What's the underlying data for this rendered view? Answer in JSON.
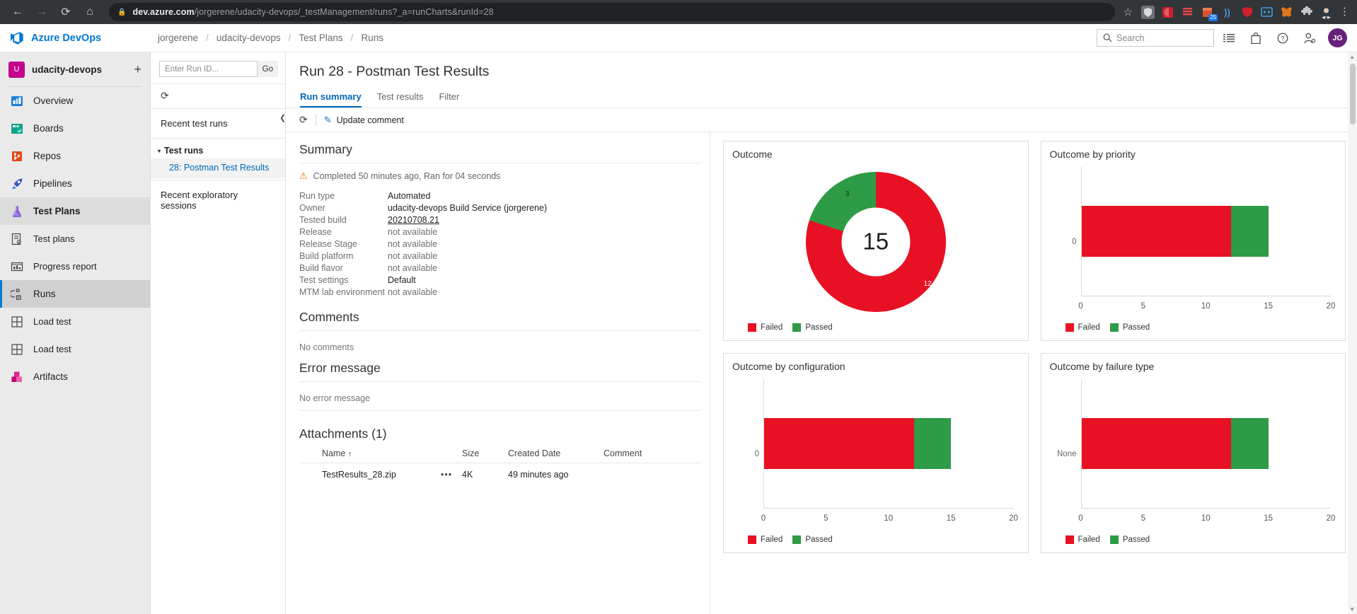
{
  "browser": {
    "back_icon": "back-arrow",
    "forward_icon": "forward-arrow",
    "reload_icon": "reload",
    "home_icon": "home",
    "lock_icon": "lock",
    "url_domain": "dev.azure.com",
    "url_path": "/jorgerene/udacity-devops/_testManagement/runs?_a=runCharts&runId=28",
    "star_icon": "bookmark-star",
    "menu_icon": "kebab-menu",
    "extensions": [
      {
        "name": "bitwarden-extension",
        "color": "#5a5f63",
        "glyph": "⛉"
      },
      {
        "name": "adobe-extension",
        "color": "#c8202f",
        "glyph": ""
      },
      {
        "name": "grammarly-extension",
        "color": "#e33d3d",
        "glyph": ""
      },
      {
        "name": "pocket-extension",
        "color": "#d9542b",
        "glyph": "",
        "badge": "25"
      },
      {
        "name": "wifi-extension",
        "color": "#1f6fd0",
        "glyph": "))"
      },
      {
        "name": "ublock-extension",
        "color": "#c8202f",
        "glyph": ""
      },
      {
        "name": "lastpass-extension",
        "color": "#0b82c9",
        "glyph": ""
      },
      {
        "name": "metamask-extension",
        "color": "#e2761b",
        "glyph": ""
      },
      {
        "name": "puzzle-extension",
        "color": "#b9bcbe",
        "glyph": ""
      },
      {
        "name": "profile-avatar",
        "color": "#8e7b6b",
        "glyph": ""
      }
    ]
  },
  "header": {
    "logo_icon": "azure-devops-logo",
    "logo_text": "Azure DevOps",
    "breadcrumb": [
      "jorgerene",
      "udacity-devops",
      "Test Plans",
      "Runs"
    ],
    "breadcrumb_separator": "/",
    "search_placeholder": "Search",
    "search_icon": "search-icon",
    "icons": [
      {
        "name": "backlog-icon",
        "glyph": "≣"
      },
      {
        "name": "marketplace-bag-icon",
        "glyph": "▭"
      },
      {
        "name": "help-icon",
        "glyph": "?"
      },
      {
        "name": "user-settings-icon",
        "glyph": "☺"
      }
    ],
    "avatar_initials": "JG"
  },
  "sidebar": {
    "project_initial": "U",
    "project_name": "udacity-devops",
    "add_icon": "plus-icon",
    "items": [
      {
        "label": "Overview",
        "icon": "overview-icon",
        "state": "normal"
      },
      {
        "label": "Boards",
        "icon": "boards-icon",
        "state": "normal"
      },
      {
        "label": "Repos",
        "icon": "repos-icon",
        "state": "normal"
      },
      {
        "label": "Pipelines",
        "icon": "pipelines-icon",
        "state": "normal"
      },
      {
        "label": "Test Plans",
        "icon": "test-plans-icon",
        "state": "group-active"
      },
      {
        "label": "Test plans",
        "icon": "test-plan-doc-icon",
        "state": "sub"
      },
      {
        "label": "Progress report",
        "icon": "progress-report-icon",
        "state": "sub"
      },
      {
        "label": "Runs",
        "icon": "runs-icon",
        "state": "active"
      },
      {
        "label": "Load test",
        "icon": "grid-icon",
        "state": "sub"
      },
      {
        "label": "Load test",
        "icon": "grid-icon",
        "state": "sub"
      },
      {
        "label": "Artifacts",
        "icon": "artifacts-icon",
        "state": "normal"
      }
    ]
  },
  "runs_pane": {
    "run_id_placeholder": "Enter Run ID...",
    "go_label": "Go",
    "refresh_icon": "refresh-icon",
    "recent_test_runs": "Recent test runs",
    "group_label": "Test runs",
    "collapse_caret": "▼",
    "selected_run": "28: Postman Test Results",
    "recent_exploratory": "Recent exploratory sessions",
    "collapse_panel_icon": "chevron-left-icon"
  },
  "main": {
    "title": "Run 28 - Postman Test Results",
    "tabs": [
      {
        "label": "Run summary",
        "active": true
      },
      {
        "label": "Test results",
        "active": false
      },
      {
        "label": "Filter",
        "active": false
      }
    ],
    "toolbar": {
      "refresh_icon": "refresh-icon",
      "update_comment_icon": "pencil-icon",
      "update_comment_label": "Update comment"
    },
    "summary": {
      "heading": "Summary",
      "warning_icon": "warning-triangle-icon",
      "status_text": "Completed 50 minutes ago, Ran for 04 seconds",
      "fields": [
        {
          "key": "Run type",
          "value": "Automated",
          "style": "normal"
        },
        {
          "key": "Owner",
          "value": "udacity-devops Build Service (jorgerene)",
          "style": "normal"
        },
        {
          "key": "Tested build",
          "value": "20210708.21",
          "style": "link"
        },
        {
          "key": "Release",
          "value": "not available",
          "style": "muted"
        },
        {
          "key": "Release Stage",
          "value": "not available",
          "style": "muted"
        },
        {
          "key": "Build platform",
          "value": "not available",
          "style": "muted"
        },
        {
          "key": "Build flavor",
          "value": "not available",
          "style": "muted"
        },
        {
          "key": "Test settings",
          "value": "Default",
          "style": "normal"
        },
        {
          "key": "MTM lab environment",
          "value": "not available",
          "style": "muted"
        }
      ]
    },
    "comments": {
      "heading": "Comments",
      "body": "No comments"
    },
    "error_message": {
      "heading": "Error message",
      "body": "No error message"
    },
    "attachments": {
      "heading": "Attachments (1)",
      "sort_indicator": "↑",
      "columns": [
        "Name",
        "Size",
        "Created Date",
        "Comment"
      ],
      "rows": [
        {
          "name": "TestResults_28.zip",
          "overflow": "•••",
          "size": "4K",
          "created": "49 minutes ago",
          "comment": ""
        }
      ]
    }
  },
  "colors": {
    "failed": "#e81123",
    "passed": "#2e9b46",
    "accent": "#0078d4",
    "link": "#0067b8"
  },
  "chart_data": [
    {
      "type": "pie",
      "title": "Outcome",
      "center_label": "15",
      "total": 15,
      "categories": [
        "Failed",
        "Passed"
      ],
      "values": [
        12,
        3
      ],
      "colors": [
        "#e81123",
        "#2e9b46"
      ],
      "slice_labels": [
        "12",
        "3"
      ],
      "legend": [
        "Failed",
        "Passed"
      ],
      "legend_position": "bottom"
    },
    {
      "type": "bar",
      "title": "Outcome by priority",
      "orientation": "horizontal",
      "stacked": true,
      "categories": [
        "0"
      ],
      "ylabel": "",
      "xlabel": "",
      "xlim": [
        0,
        20
      ],
      "xticks": [
        0,
        5,
        10,
        15,
        20
      ],
      "grid": false,
      "series": [
        {
          "name": "Failed",
          "values": [
            12
          ],
          "color": "#e81123"
        },
        {
          "name": "Passed",
          "values": [
            3
          ],
          "color": "#2e9b46"
        }
      ],
      "legend": [
        "Failed",
        "Passed"
      ],
      "legend_position": "bottom"
    },
    {
      "type": "bar",
      "title": "Outcome by configuration",
      "orientation": "horizontal",
      "stacked": true,
      "categories": [
        "0"
      ],
      "ylabel": "",
      "xlabel": "",
      "xlim": [
        0,
        20
      ],
      "xticks": [
        0,
        5,
        10,
        15,
        20
      ],
      "grid": false,
      "series": [
        {
          "name": "Failed",
          "values": [
            12
          ],
          "color": "#e81123"
        },
        {
          "name": "Passed",
          "values": [
            3
          ],
          "color": "#2e9b46"
        }
      ],
      "legend": [
        "Failed",
        "Passed"
      ],
      "legend_position": "bottom"
    },
    {
      "type": "bar",
      "title": "Outcome by failure type",
      "orientation": "horizontal",
      "stacked": true,
      "categories": [
        "None"
      ],
      "ylabel": "",
      "xlabel": "",
      "xlim": [
        0,
        20
      ],
      "xticks": [
        0,
        5,
        10,
        15,
        20
      ],
      "grid": false,
      "series": [
        {
          "name": "Failed",
          "values": [
            12
          ],
          "color": "#e81123"
        },
        {
          "name": "Passed",
          "values": [
            3
          ],
          "color": "#2e9b46"
        }
      ],
      "legend": [
        "Failed",
        "Passed"
      ],
      "legend_position": "bottom"
    }
  ]
}
